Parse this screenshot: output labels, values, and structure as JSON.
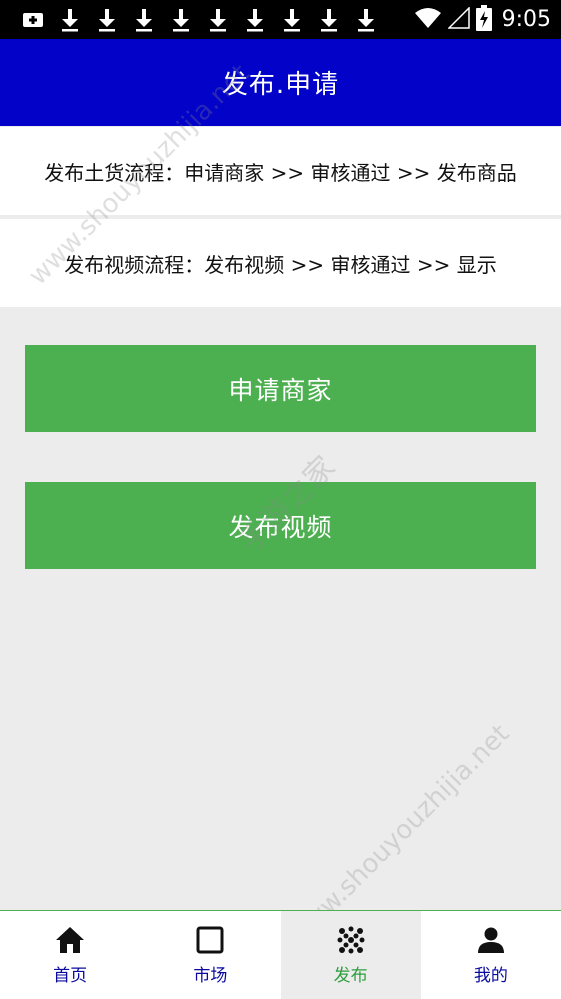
{
  "status_bar": {
    "time": "9:05",
    "icons": [
      "notification-plus-icon",
      "download-icon",
      "download-icon",
      "download-icon",
      "download-icon",
      "download-icon",
      "download-icon",
      "download-icon",
      "download-icon",
      "download-icon",
      "wifi-icon",
      "signal-icon",
      "battery-charging-icon"
    ]
  },
  "header": {
    "title": "发布.申请",
    "background": "#0202c8"
  },
  "process": {
    "goods": "发布土货流程：申请商家 >> 审核通过 >> 发布商品",
    "video": "发布视频流程：发布视频 >> 审核通过 >> 显示"
  },
  "actions": {
    "apply_merchant": "申请商家",
    "publish_video": "发布视频",
    "color": "#4caf50"
  },
  "bottom_nav": {
    "items": [
      {
        "label": "首页",
        "icon": "home-icon"
      },
      {
        "label": "市场",
        "icon": "square-icon"
      },
      {
        "label": "发布",
        "icon": "dots-grid-icon",
        "active": true
      },
      {
        "label": "我的",
        "icon": "person-icon"
      }
    ]
  },
  "watermark": {
    "text": "www.shouyouzhijia.net",
    "center_text": "手游之家"
  }
}
